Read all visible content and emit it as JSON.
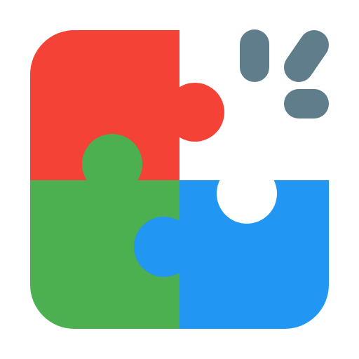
{
  "icon": {
    "name": "puzzle-icon",
    "pieces": [
      {
        "name": "red-puzzle-piece",
        "color": "#F44336"
      },
      {
        "name": "green-puzzle-piece",
        "color": "#4CAF50"
      },
      {
        "name": "blue-puzzle-piece",
        "color": "#2196F3"
      }
    ],
    "missing_piece": {
      "name": "missing-piece-slot",
      "color": "#FFFFFF"
    },
    "sparkle": {
      "name": "sparkle-lines-icon",
      "color": "#607D8B"
    }
  }
}
